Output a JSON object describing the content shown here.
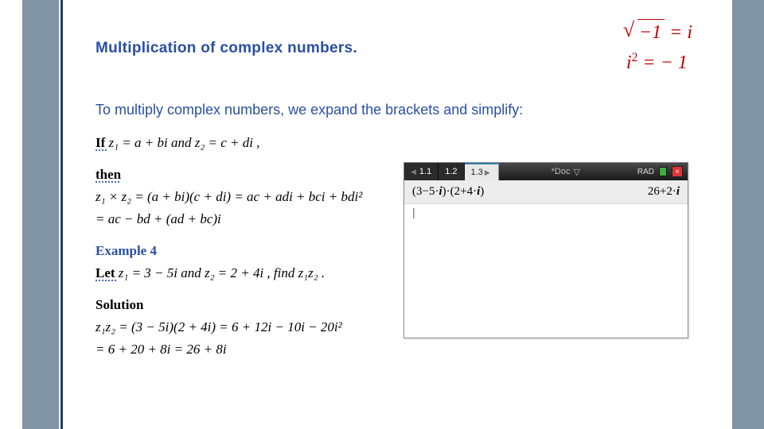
{
  "heading": "Multiplication of complex numbers.",
  "topFormula": {
    "line1_radicand": "−1",
    "line1_rhs": " = i",
    "line2": "i² = − 1"
  },
  "intro": "To multiply complex numbers, we expand the brackets and simplify:",
  "math": {
    "if_word": "If ",
    "if_expr": "z₁ = a + bi  and  z₂ = c + di ,",
    "then_word": "then",
    "prod1": "z₁ × z₂ = (a + bi)(c + di) = ac + adi + bci + bdi²",
    "prod2": "= ac − bd + (ad + bc)i",
    "example_label": "Example 4",
    "let_word": "Let ",
    "let_expr": "z₁ = 3 − 5i  and  z₂ = 2 + 4i ,  find  z₁z₂ .",
    "solution_label": "Solution",
    "sol1": "z₁z₂ = (3 − 5i)(2 + 4i) = 6 + 12i − 10i − 20i²",
    "sol2": "= 6 + 20 + 8i = 26 + 8i"
  },
  "calc": {
    "tabs": [
      "1.1",
      "1.2",
      "1.3"
    ],
    "activeTab": 2,
    "doc": "*Doc",
    "mode": "RAD",
    "expr_lhs": "(3−5·i)·(2+4·i)",
    "expr_rhs": "26+2·i",
    "cursor": "|"
  }
}
